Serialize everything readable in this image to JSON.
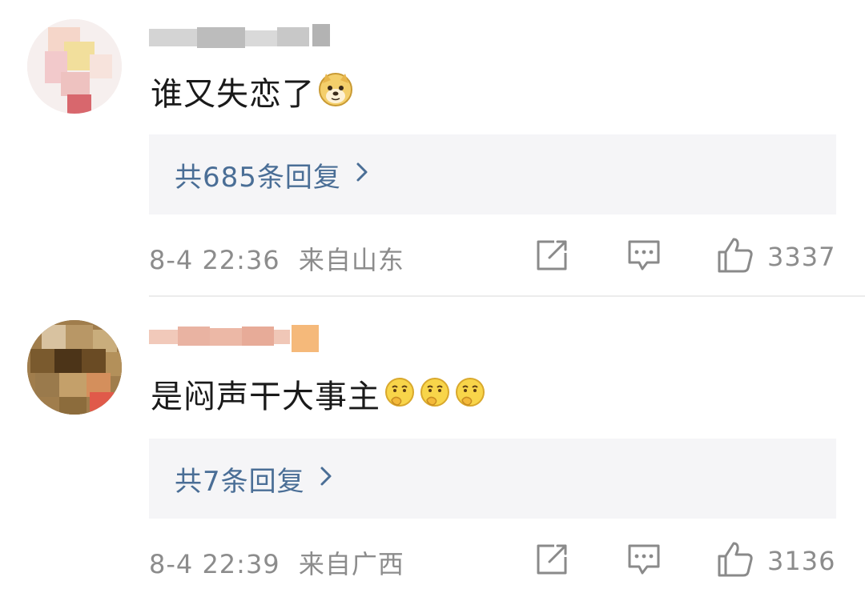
{
  "comments": [
    {
      "text": "谁又失恋了",
      "emoji_icons": [
        "doge-emoji-icon"
      ],
      "replies_label": "共685条回复",
      "time": "8-4 22:36",
      "location": "来自山东",
      "likes": "3337"
    },
    {
      "text": "是闷声干大事主",
      "emoji_icons": [
        "thinking-emoji-icon",
        "thinking-emoji-icon",
        "thinking-emoji-icon"
      ],
      "replies_label": "共7条回复",
      "time": "8-4 22:39",
      "location": "来自广西",
      "likes": "3136"
    }
  ],
  "icons": {
    "share": "share-icon",
    "comment": "comment-icon",
    "like": "thumbs-up-icon",
    "chevron": "chevron-right-icon"
  },
  "colors": {
    "link": "#4a6e96",
    "meta": "#8c8c8c",
    "reply_bg": "#f5f5f7"
  }
}
